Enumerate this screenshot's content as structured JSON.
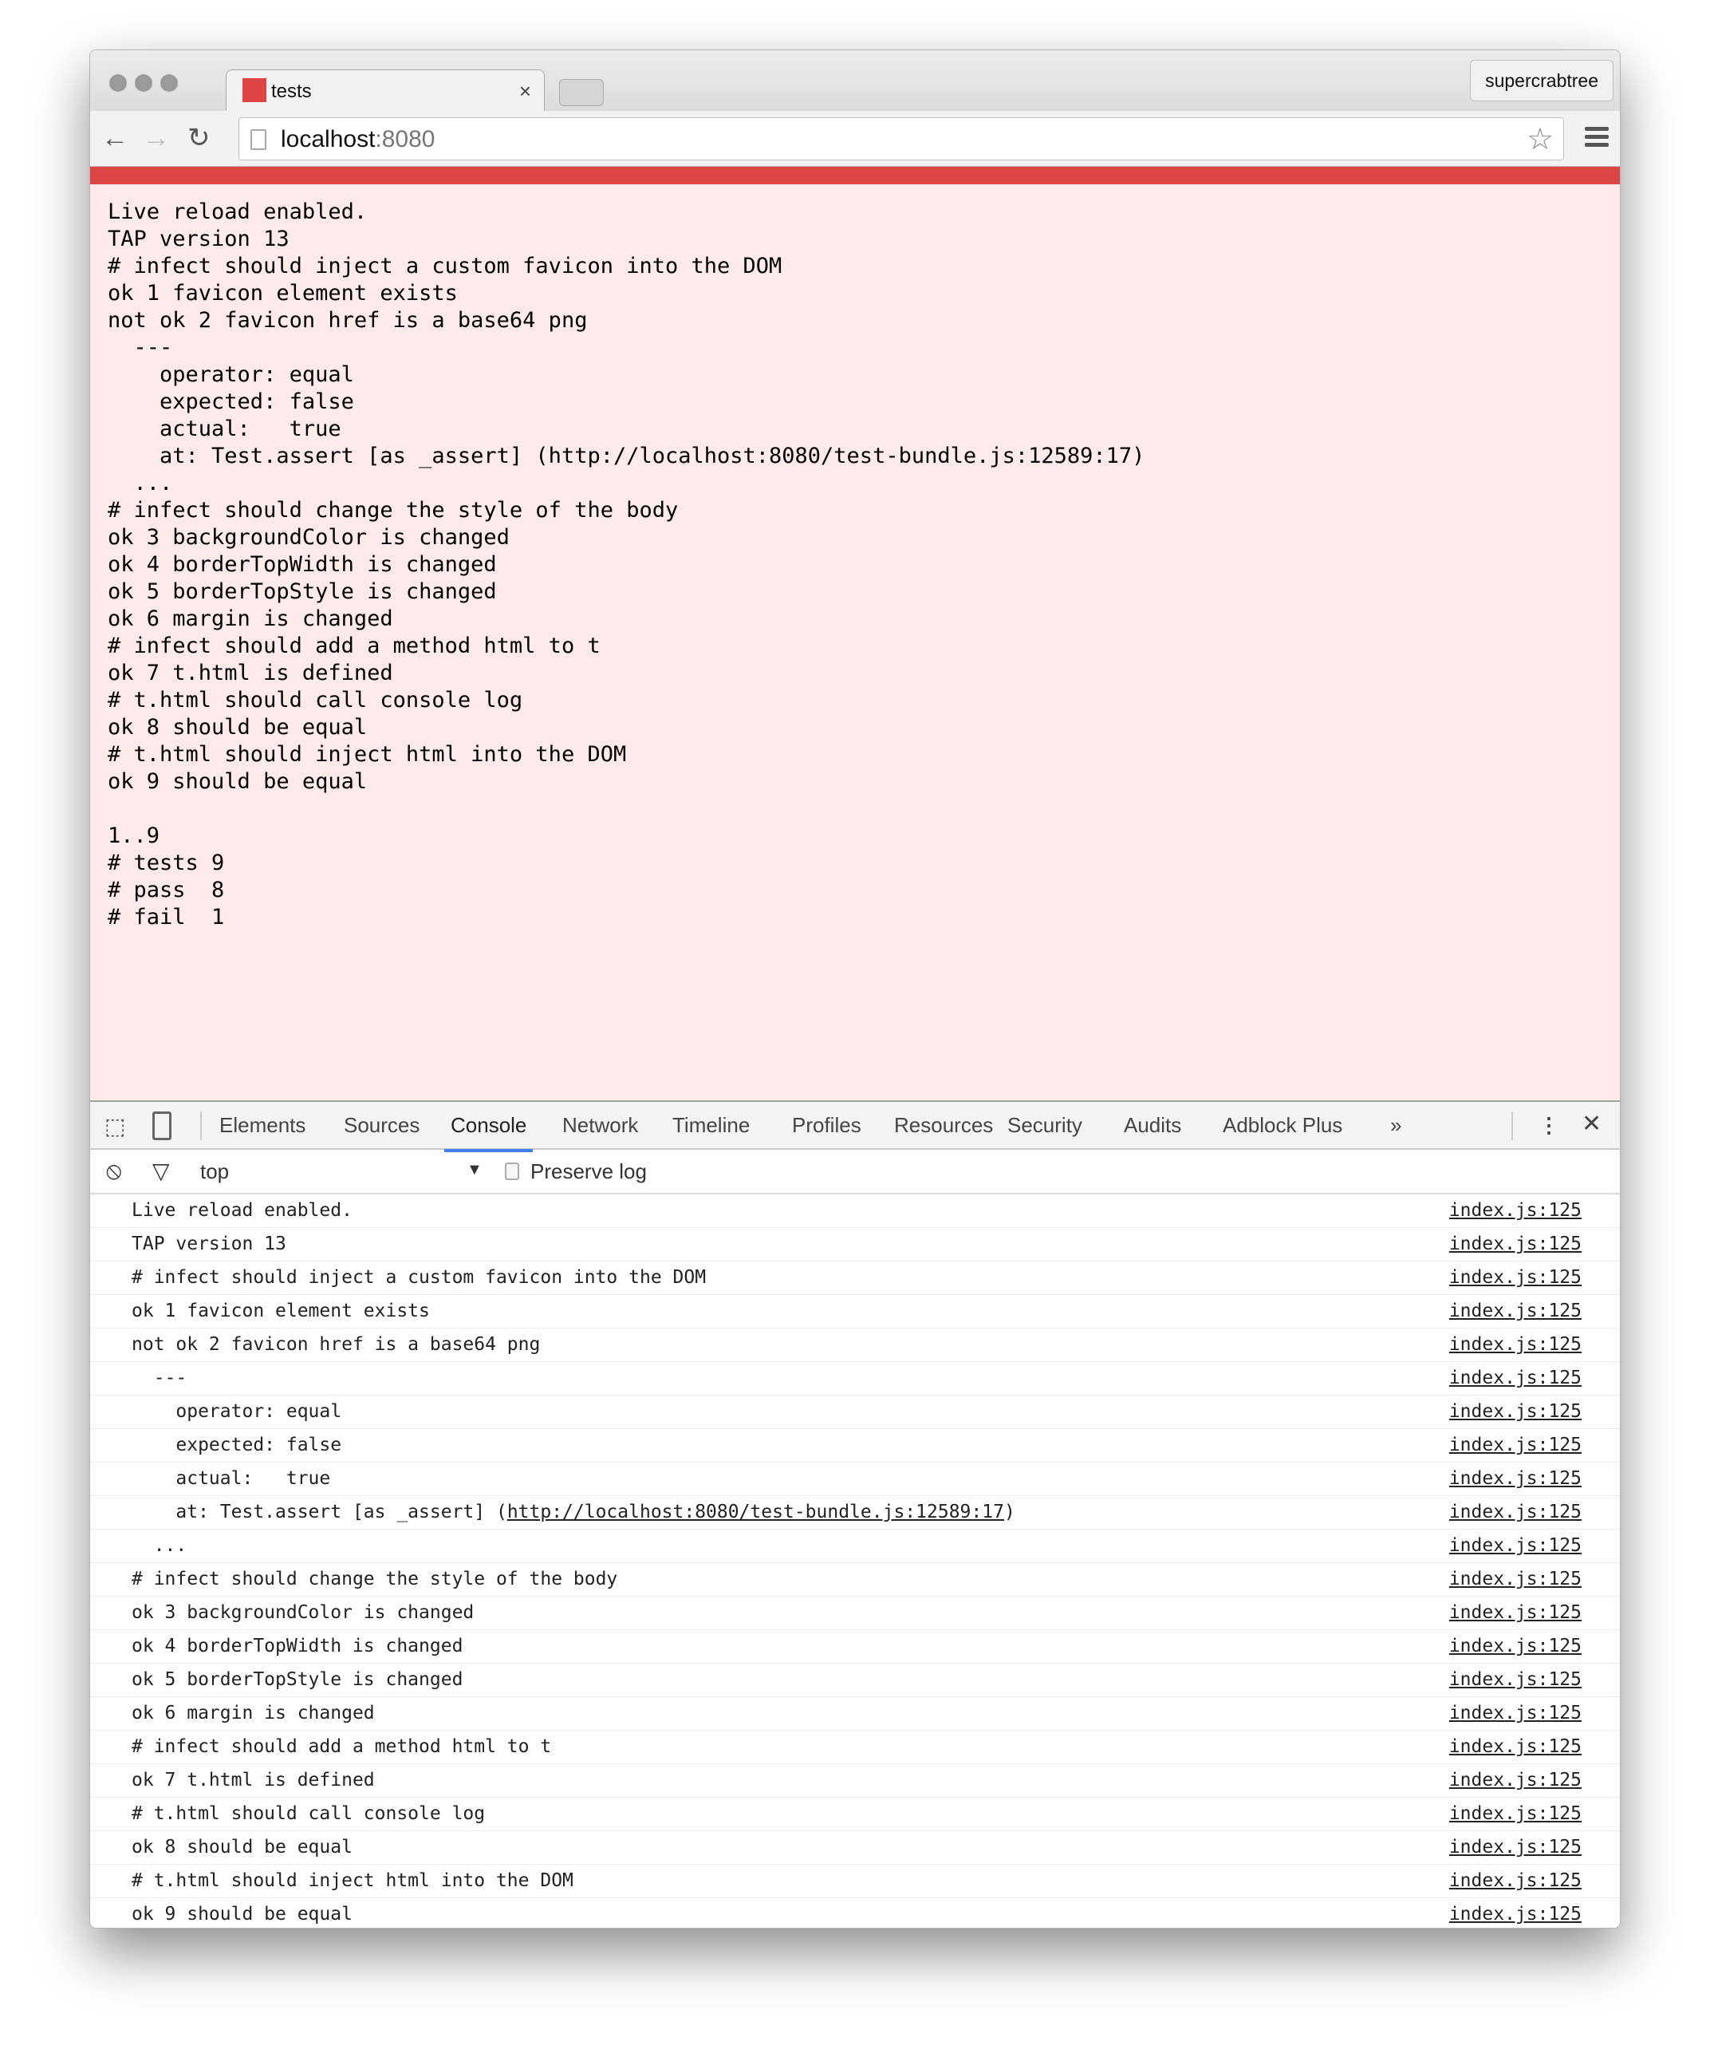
{
  "browser": {
    "tab_title": "tests",
    "tab_close": "×",
    "profile": "supercrabtree",
    "url_host": "localhost",
    "url_port": ":8080",
    "accent": "#dd4444"
  },
  "page": {
    "lines": [
      "Live reload enabled.",
      "TAP version 13",
      "# infect should inject a custom favicon into the DOM",
      "ok 1 favicon element exists",
      "not ok 2 favicon href is a base64 png",
      "  ---",
      "    operator: equal",
      "    expected: false",
      "    actual:   true",
      "    at: Test.assert [as _assert] (http://localhost:8080/test-bundle.js:12589:17)",
      "  ...",
      "# infect should change the style of the body",
      "ok 3 backgroundColor is changed",
      "ok 4 borderTopWidth is changed",
      "ok 5 borderTopStyle is changed",
      "ok 6 margin is changed",
      "# infect should add a method html to t",
      "ok 7 t.html is defined",
      "# t.html should call console log",
      "ok 8 should be equal",
      "# t.html should inject html into the DOM",
      "ok 9 should be equal",
      "",
      "1..9",
      "# tests 9",
      "# pass  8",
      "# fail  1"
    ]
  },
  "devtools": {
    "tabs": [
      "Elements",
      "Sources",
      "Console",
      "Network",
      "Timeline",
      "Profiles",
      "Resources",
      "Security",
      "Audits",
      "Adblock Plus"
    ],
    "active_tab": "Console",
    "more": "»",
    "context": "top",
    "preserve_log": "Preserve log",
    "source": "index.js:125",
    "console_lines": [
      "Live reload enabled.",
      "TAP version 13",
      "# infect should inject a custom favicon into the DOM",
      "ok 1 favicon element exists",
      "not ok 2 favicon href is a base64 png",
      "  ---",
      "    operator: equal",
      "    expected: false",
      "    actual:   true",
      "    at: Test.assert [as _assert] (",
      "  ...",
      "# infect should change the style of the body",
      "ok 3 backgroundColor is changed",
      "ok 4 borderTopWidth is changed",
      "ok 5 borderTopStyle is changed",
      "ok 6 margin is changed",
      "# infect should add a method html to t",
      "ok 7 t.html is defined",
      "# t.html should call console log",
      "ok 8 should be equal",
      "# t.html should inject html into the DOM",
      "ok 9 should be equal"
    ],
    "link": "http://localhost:8080/test-bundle.js:12589:17",
    "link_close": ")"
  }
}
